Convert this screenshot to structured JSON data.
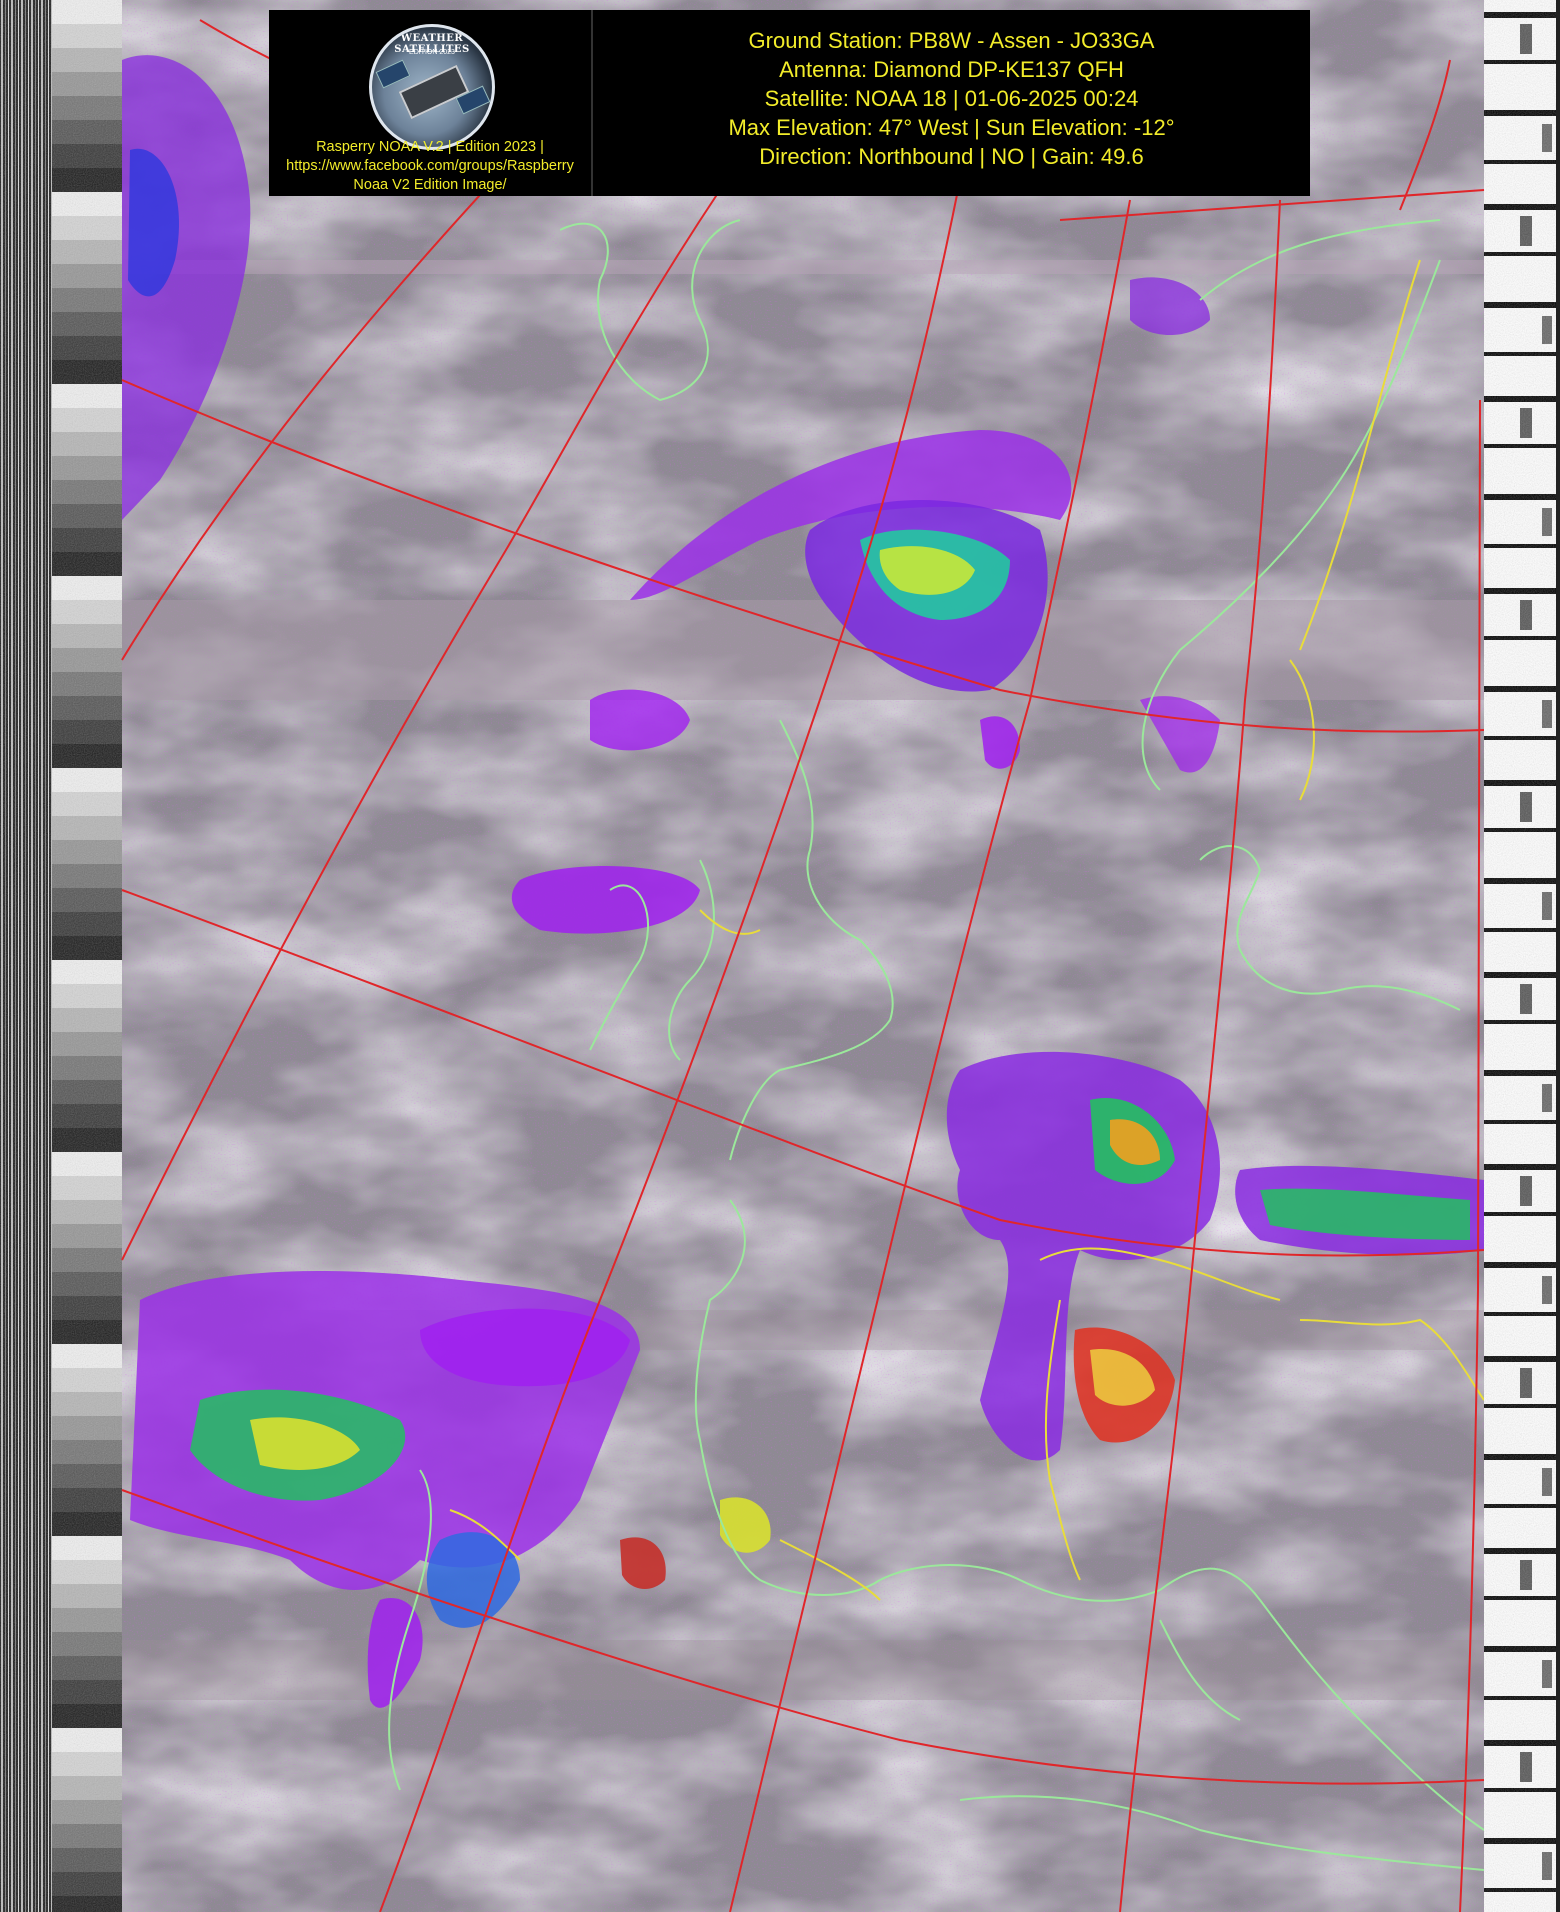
{
  "header": {
    "logo": {
      "badge_title": "WEATHER SATELLITES",
      "badge_subtitle": "EDITION 2023",
      "caption_lines": [
        "Rasperry NOAA V.2 | Edition 2023 |",
        "https://www.facebook.com/groups/Raspberry",
        "Noaa V2 Edition Image/"
      ]
    },
    "info_lines": [
      "Ground Station: PB8W - Assen - JO33GA",
      "Antenna: Diamond DP-KE137 QFH",
      "Satellite: NOAA 18 | 01-06-2025 00:24",
      "Max Elevation: 47° West | Sun Elevation: -12°",
      "Direction: Northbound | NO | Gain: 49.6"
    ]
  },
  "colors": {
    "text": "#f2ec2a",
    "graticule": "#e0262a",
    "coastline": "#9be89b",
    "border": "#e8dc3a",
    "cloud_low": "#c8c2ce",
    "cloud_cold": "#a020f0"
  },
  "icons": [
    "satellite-badge-icon"
  ]
}
